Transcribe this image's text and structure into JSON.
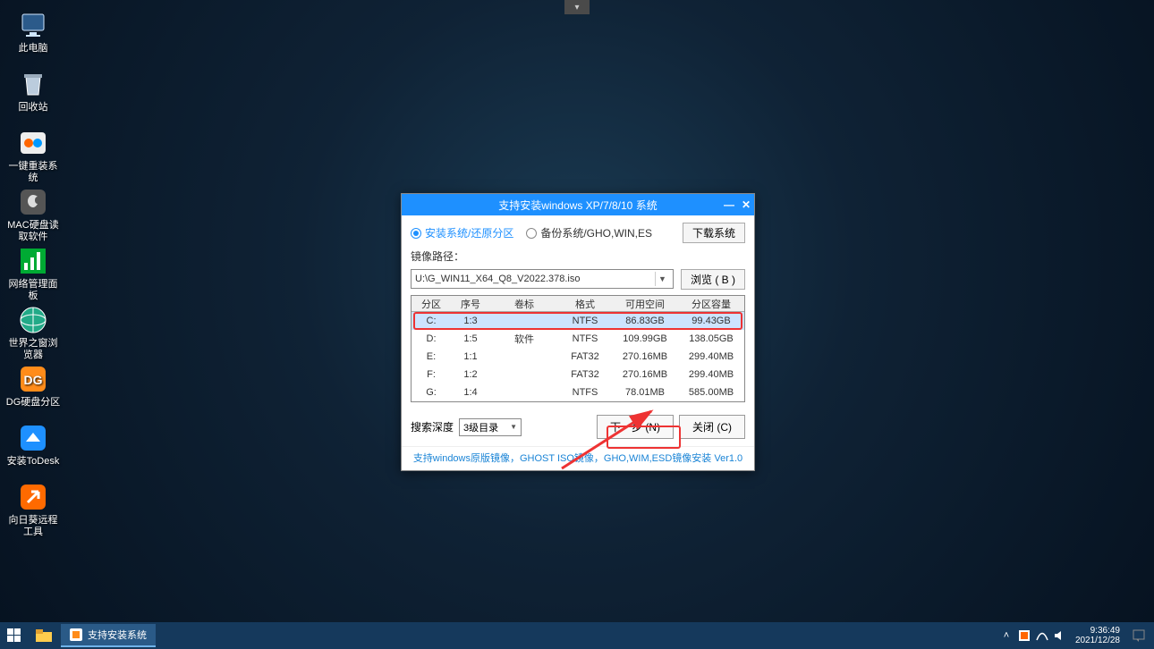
{
  "desktop_icons": [
    {
      "key": "this-pc",
      "label": "此电脑"
    },
    {
      "key": "recycle-bin",
      "label": "回收站"
    },
    {
      "key": "one-key-install",
      "label": "一键重装系统"
    },
    {
      "key": "mac-disk-reader",
      "label": "MAC硬盘读取软件"
    },
    {
      "key": "network-panel",
      "label": "网络管理面板"
    },
    {
      "key": "world-browser",
      "label": "世界之窗浏览器"
    },
    {
      "key": "dg-partition",
      "label": "DG硬盘分区"
    },
    {
      "key": "install-todesk",
      "label": "安装ToDesk"
    },
    {
      "key": "sunflower-remote",
      "label": "向日葵远程工具"
    }
  ],
  "dialog": {
    "title": "支持安装windows XP/7/8/10 系统",
    "radio_install": "安装系统/还原分区",
    "radio_backup": "备份系统/GHO,WIN,ES",
    "download_btn": "下载系统",
    "path_label": "镜像路径：",
    "path_value": "U:\\G_WIN11_X64_Q8_V2022.378.iso",
    "browse_btn": "浏览 ( B )",
    "headers": {
      "part": "分区",
      "seq": "序号",
      "vol": "卷标",
      "fmt": "格式",
      "avail": "可用空间",
      "cap": "分区容量"
    },
    "rows": [
      {
        "part": "C:",
        "seq": "1:3",
        "vol": "",
        "fmt": "NTFS",
        "avail": "86.83GB",
        "cap": "99.43GB",
        "selected": true
      },
      {
        "part": "D:",
        "seq": "1:5",
        "vol": "软件",
        "fmt": "NTFS",
        "avail": "109.99GB",
        "cap": "138.05GB"
      },
      {
        "part": "E:",
        "seq": "1:1",
        "vol": "",
        "fmt": "FAT32",
        "avail": "270.16MB",
        "cap": "299.40MB"
      },
      {
        "part": "F:",
        "seq": "1:2",
        "vol": "",
        "fmt": "FAT32",
        "avail": "270.16MB",
        "cap": "299.40MB"
      },
      {
        "part": "G:",
        "seq": "1:4",
        "vol": "",
        "fmt": "NTFS",
        "avail": "78.01MB",
        "cap": "585.00MB"
      }
    ],
    "search_depth_label": "搜索深度",
    "search_depth_value": "3级目录",
    "next_btn": "下一步 (N)",
    "close_btn": "关闭 (C)",
    "footer": "支持windows原版镜像，GHOST ISO镜像，GHO,WIM,ESD镜像安装 Ver1.0"
  },
  "taskbar": {
    "app_label": "支持安装系统",
    "time": "9:36:49",
    "date": "2021/12/28"
  }
}
